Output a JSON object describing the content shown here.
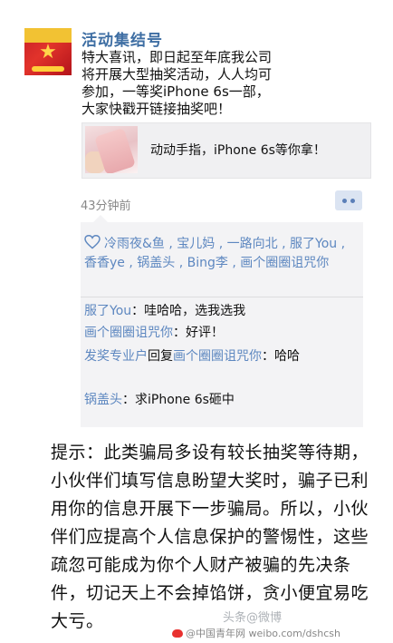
{
  "post": {
    "author": "活动集结号",
    "content": "特大喜讯，即日起至年底我公司\n将开展大型抽奖活动，人人均可\n参加，一等奖iPhone 6s一部，\n大家快戳开链接抽奖吧！",
    "link_title": "动动手指，iPhone 6s等你拿！",
    "time": "43分钟前"
  },
  "likes": {
    "names": [
      "冷雨夜&鱼",
      "宝儿妈",
      "一路向北",
      "服了You",
      "香香ye",
      "锅盖头",
      "Bing李",
      "画个圈圈诅咒你"
    ]
  },
  "comments": [
    {
      "author": "服了You",
      "reply_to": "",
      "text": "：哇哈哈，选我选我"
    },
    {
      "author": "画个圈圈诅咒你",
      "reply_to": "",
      "text": "：好评！"
    },
    {
      "author": "发奖专业户",
      "reply_label": "回复",
      "reply_to": "画个圈圈诅咒你",
      "text": "：哈哈"
    },
    {
      "author": "锅盖头",
      "reply_to": "",
      "text": "：求iPhone 6s砸中"
    }
  ],
  "tip": {
    "text": "提示：此类骗局多设有较长抽奖等待期，小伙伴们填写信息盼望大奖时，骗子已利用你的信息开展下一步骗局。所以，小伙伴们应提高个人信息保护的警惕性，这些疏忽可能成为你个人财产被骗的先决条件，切记天上不会掉馅饼，贪小便宜易吃大亏。"
  },
  "watermark": "头条@微博",
  "footer": {
    "text": "@中国青年网 weibo.com/dshcsh"
  },
  "colors": {
    "link_blue": "#5d87c0",
    "name_blue": "#3e6ea3",
    "comment_bg": "#f3f3f5"
  },
  "icons": [
    "heart-icon",
    "more-dots-icon",
    "weibo-icon"
  ]
}
